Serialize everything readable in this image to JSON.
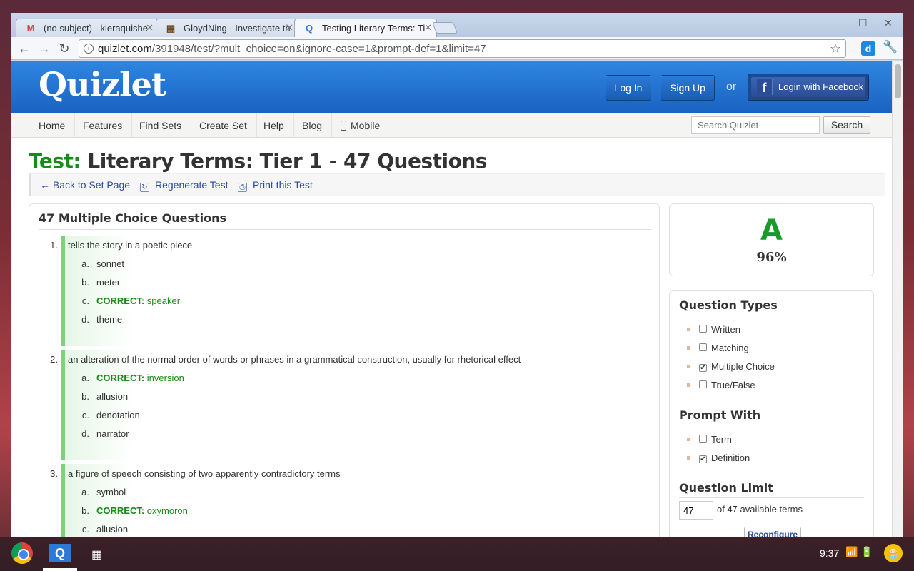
{
  "browser": {
    "tabs": [
      {
        "title": "(no subject) - kieraquishe",
        "icon": "gmail-icon"
      },
      {
        "title": "GloydNing - Investigate th",
        "icon": "site-icon"
      },
      {
        "title": "Testing Literary Terms: Ti",
        "icon": "quizlet-icon"
      }
    ],
    "url_host": "quizlet.com",
    "url_path": "/391948/test/?mult_choice=on&ignore-case=1&prompt-def=1&limit=47"
  },
  "header": {
    "logo": "Quizlet",
    "login": "Log In",
    "signup": "Sign Up",
    "or": "or",
    "facebook": "Login with Facebook"
  },
  "nav": {
    "items": [
      "Home",
      "Features",
      "Find Sets",
      "Create Set",
      "Help",
      "Blog",
      "Mobile"
    ],
    "search_placeholder": "Search Quizlet",
    "search_button": "Search"
  },
  "page": {
    "title_prefix": "Test:",
    "title": "Literary Terms: Tier 1 - 47 Questions",
    "actions": {
      "back": "← Back to Set Page",
      "regenerate": "Regenerate Test",
      "print": "Print this Test"
    }
  },
  "questions": {
    "heading": "47 Multiple Choice Questions",
    "correct_label": "CORRECT:",
    "items": [
      {
        "num": "1.",
        "text": "tells the story in a poetic piece",
        "options": [
          {
            "l": "a.",
            "t": "sonnet"
          },
          {
            "l": "b.",
            "t": "meter"
          },
          {
            "l": "c.",
            "t": "speaker"
          },
          {
            "l": "d.",
            "t": "theme"
          }
        ]
      },
      {
        "num": "2.",
        "text": "an alteration of the normal order of words or phrases in a grammatical construction, usually for rhetorical effect",
        "options": [
          {
            "l": "a.",
            "t": "inversion"
          },
          {
            "l": "b.",
            "t": "allusion"
          },
          {
            "l": "c.",
            "t": "denotation"
          },
          {
            "l": "d.",
            "t": "narrator"
          }
        ]
      },
      {
        "num": "3.",
        "text": "a figure of speech consisting of two apparently contradictory terms",
        "options": [
          {
            "l": "a.",
            "t": "symbol"
          },
          {
            "l": "b.",
            "t": "oxymoron"
          },
          {
            "l": "c.",
            "t": "allusion"
          }
        ]
      }
    ]
  },
  "sidebar": {
    "grade": "A",
    "percent": "96%",
    "question_types_title": "Question Types",
    "question_types": [
      "Written",
      "Matching",
      "Multiple Choice",
      "True/False"
    ],
    "question_types_checked": [
      false,
      false,
      true,
      false
    ],
    "prompt_with_title": "Prompt With",
    "prompt_with": [
      "Term",
      "Definition"
    ],
    "prompt_with_checked": [
      false,
      true
    ],
    "question_limit_title": "Question Limit",
    "limit_value": "47",
    "limit_text": "of 47 available terms",
    "reconfigure": "Reconfigure"
  },
  "shelf": {
    "time": "9:37"
  }
}
